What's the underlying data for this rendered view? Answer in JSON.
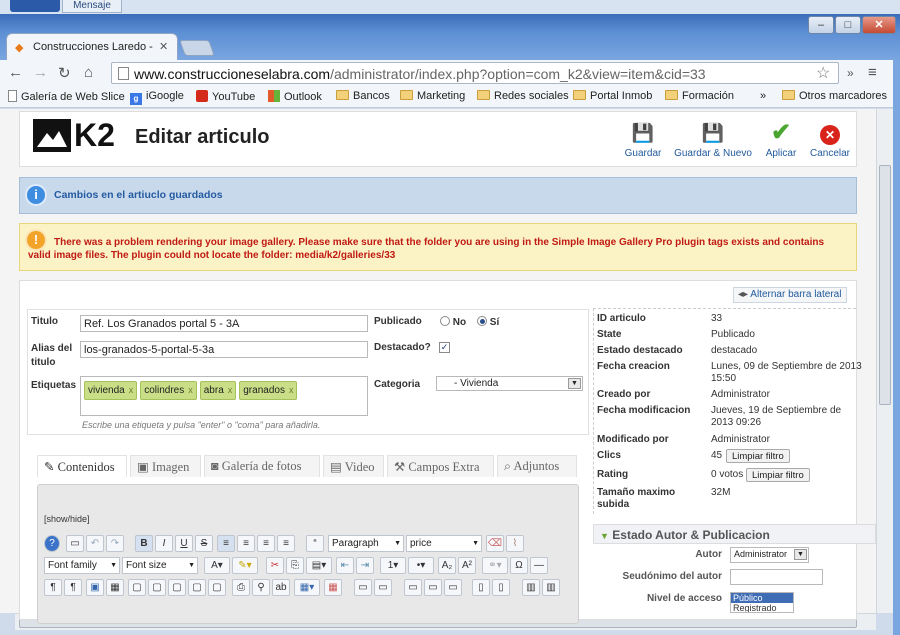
{
  "os": {
    "taskbar_tab": "Mensaje"
  },
  "browser": {
    "tab_title": "Construcciones Laredo - P",
    "url_host": "www.construccioneselabra.com",
    "url_path": "/administrator/index.php?option=com_k2&view=item&cid=33",
    "bookmarks": [
      {
        "label": "Galería de Web Slice"
      },
      {
        "label": "iGoogle"
      },
      {
        "label": "YouTube"
      },
      {
        "label": "Outlook"
      },
      {
        "label": "Bancos"
      },
      {
        "label": "Marketing"
      },
      {
        "label": "Redes sociales"
      },
      {
        "label": "Portal Inmob"
      },
      {
        "label": "Formación"
      },
      {
        "label": "»"
      },
      {
        "label": "Otros marcadores"
      }
    ]
  },
  "header": {
    "logo_text": "K2",
    "title": "Editar articulo",
    "buttons": {
      "save": "Guardar",
      "save_new": "Guardar & Nuevo",
      "apply": "Aplicar",
      "cancel": "Cancelar"
    }
  },
  "messages": {
    "info": "Cambios en el artiuclo guardados",
    "warning": "There was a problem rendering your image gallery. Please make sure that the folder you are using in the Simple Image Gallery Pro plugin tags exists and contains valid image files. The plugin could not locate the folder: media/k2/galleries/33"
  },
  "form": {
    "titulo_label": "Titulo",
    "titulo_value": "Ref. Los Granados portal 5 - 3A",
    "alias_label": "Alias del titulo",
    "alias_value": "los-granados-5-portal-5-3a",
    "etiquetas_label": "Etiquetas",
    "tags": [
      "vivienda",
      "colindres",
      "abra",
      "granados"
    ],
    "tag_remove": "x",
    "tag_hint": "Escribe una etiqueta y pulsa \"enter\" o \"coma\" para añadirla.",
    "publicado_label": "Publicado",
    "no_label": "No",
    "si_label": "Sí",
    "publicado_value": "Sí",
    "destacado_label": "Destacado?",
    "destacado_checked": true,
    "categoria_label": "Categoria",
    "categoria_value": "- Vivienda"
  },
  "tabs": [
    {
      "label": "Contenidos",
      "icon": "edit-icon",
      "active": true
    },
    {
      "label": "Imagen",
      "icon": "image-icon"
    },
    {
      "label": "Galería de fotos",
      "icon": "camera-icon"
    },
    {
      "label": "Video",
      "icon": "film-icon"
    },
    {
      "label": "Campos Extra",
      "icon": "tools-icon"
    },
    {
      "label": "Adjuntos",
      "icon": "paperclip-icon"
    }
  ],
  "editor": {
    "show_hide": "[show/hide]",
    "format_select": "Paragraph",
    "style_select": "price",
    "font_family": "Font family",
    "font_size": "Font size"
  },
  "sidebar": {
    "toggle_label": "Alternar barra lateral",
    "meta": [
      {
        "key": "ID articulo",
        "value": "33"
      },
      {
        "key": "State",
        "value": "Publicado"
      },
      {
        "key": "Estado destacado",
        "value": "destacado"
      },
      {
        "key": "Fecha creacion",
        "value": "Lunes, 09 de Septiembre de 2013 15:50"
      },
      {
        "key": "Creado por",
        "value": "Administrator"
      },
      {
        "key": "Fecha modificacion",
        "value": "Jueves, 19 de Septiembre de 2013 09:26"
      },
      {
        "key": "Modificado por",
        "value": "Administrator"
      },
      {
        "key": "Clics",
        "value": "45"
      },
      {
        "key": "Rating",
        "value": "0 votos"
      },
      {
        "key": "Tamaño maximo subida",
        "value": "32M"
      }
    ],
    "reset_label": "Limpiar filtro",
    "accordion_title": "Estado Autor & Publicacion",
    "autor_label": "Autor",
    "autor_value": "Administrator",
    "seudonimo_label": "Seudónimo del autor",
    "seudonimo_value": "",
    "nivel_label": "Nivel de acceso",
    "nivel_options": [
      "Público",
      "Registrado"
    ]
  },
  "colors": {
    "accent": "#225a9c",
    "warning_text": "#c01a14",
    "info_bg": "#c9d9ec",
    "tag_bg": "#c9de86"
  }
}
